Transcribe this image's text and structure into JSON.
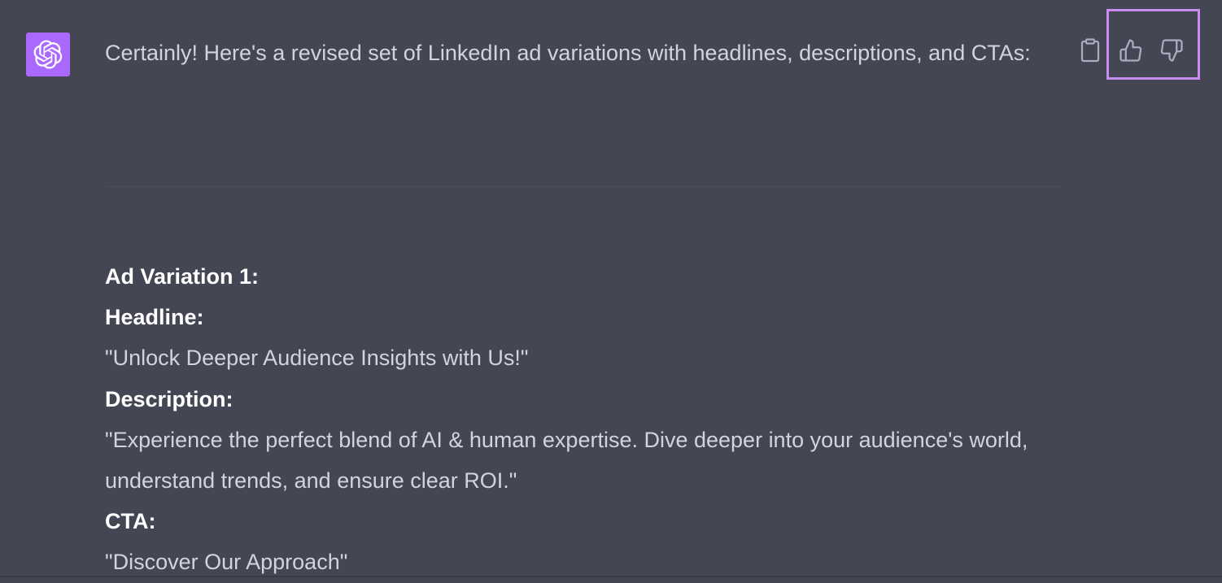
{
  "message": {
    "author_avatar_icon": "openai-logo-icon",
    "intro": "Certainly! Here's a revised set of LinkedIn ad variations with headlines, descriptions, and CTAs:",
    "variation": {
      "title": "Ad Variation 1:",
      "headline_label": "Headline:",
      "headline": "\"Unlock Deeper Audience Insights with Us!\"",
      "description_label": "Description:",
      "description": "\"Experience the perfect blend of AI & human expertise. Dive deeper into your audience's world, understand trends, and ensure clear ROI.\"",
      "cta_label": "CTA:",
      "cta": "\"Discover Our Approach\""
    }
  },
  "actions": {
    "copy_icon": "clipboard-icon",
    "like_icon": "thumbs-up-icon",
    "dislike_icon": "thumbs-down-icon"
  },
  "colors": {
    "background": "#444654",
    "avatar_bg": "#ab68ff",
    "text": "#d1d5db",
    "bold_text": "#ffffff",
    "highlight_border": "#c78ef0"
  }
}
